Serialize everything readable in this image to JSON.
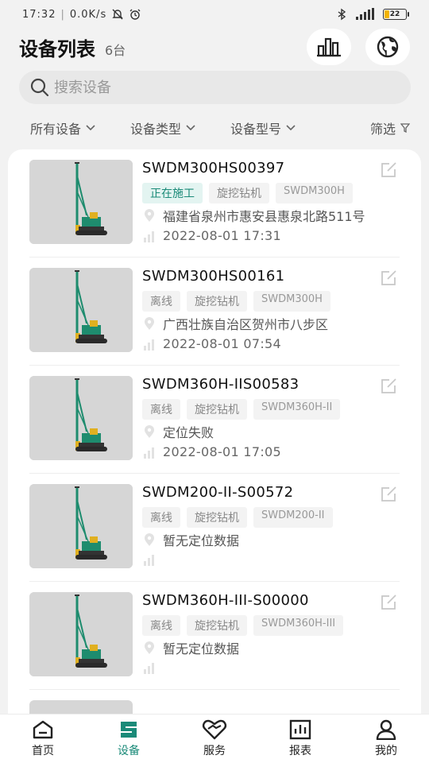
{
  "status_bar": {
    "time": "17:32",
    "network_speed": "0.0K/s",
    "battery": "22",
    "battery_level": 0.22
  },
  "header": {
    "title": "设备列表",
    "count": "6台",
    "stats_icon": "bar-chart-icon",
    "globe_icon": "globe-icon"
  },
  "search": {
    "placeholder": "搜索设备",
    "value": ""
  },
  "filters": [
    {
      "label": "所有设备"
    },
    {
      "label": "设备类型"
    },
    {
      "label": "设备型号"
    },
    {
      "label": "筛选"
    }
  ],
  "devices": [
    {
      "id": "SWDM300HS00397",
      "status": "正在施工",
      "status_active": true,
      "type": "旋挖钻机",
      "model": "SWDM300H",
      "location": "福建省泉州市惠安县惠泉北路511号",
      "time": "2022-08-01 17:31"
    },
    {
      "id": "SWDM300HS00161",
      "status": "离线",
      "status_active": false,
      "type": "旋挖钻机",
      "model": "SWDM300H",
      "location": "广西壮族自治区贺州市八步区",
      "time": "2022-08-01 07:54"
    },
    {
      "id": "SWDM360H-IIS00583",
      "status": "离线",
      "status_active": false,
      "type": "旋挖钻机",
      "model": "SWDM360H-II",
      "location": "定位失败",
      "time": "2022-08-01 17:05"
    },
    {
      "id": "SWDM200-II-S00572",
      "status": "离线",
      "status_active": false,
      "type": "旋挖钻机",
      "model": "SWDM200-II",
      "location": "暂无定位数据",
      "time": ""
    },
    {
      "id": "SWDM360H-III-S00000",
      "status": "离线",
      "status_active": false,
      "type": "旋挖钻机",
      "model": "SWDM360H-III",
      "location": "暂无定位数据",
      "time": ""
    }
  ],
  "tabs": [
    {
      "label": "首页",
      "icon": "home-icon",
      "active": false
    },
    {
      "label": "设备",
      "icon": "device-icon",
      "active": true
    },
    {
      "label": "服务",
      "icon": "service-icon",
      "active": false
    },
    {
      "label": "报表",
      "icon": "report-icon",
      "active": false
    },
    {
      "label": "我的",
      "icon": "user-icon",
      "active": false
    }
  ],
  "colors": {
    "accent": "#1a8a78",
    "background": "#f2f2f2",
    "card": "#ffffff",
    "rig_green": "#1e8c6e",
    "rig_yellow": "#e0b020"
  }
}
